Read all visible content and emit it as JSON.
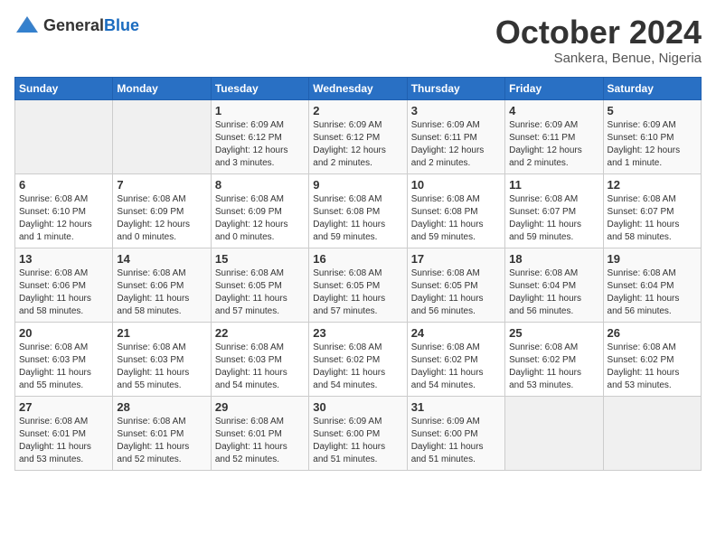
{
  "header": {
    "logo_general": "General",
    "logo_blue": "Blue",
    "month_title": "October 2024",
    "subtitle": "Sankera, Benue, Nigeria"
  },
  "days_of_week": [
    "Sunday",
    "Monday",
    "Tuesday",
    "Wednesday",
    "Thursday",
    "Friday",
    "Saturday"
  ],
  "weeks": [
    [
      {
        "day": "",
        "content": ""
      },
      {
        "day": "",
        "content": ""
      },
      {
        "day": "1",
        "content": "Sunrise: 6:09 AM\nSunset: 6:12 PM\nDaylight: 12 hours\nand 3 minutes."
      },
      {
        "day": "2",
        "content": "Sunrise: 6:09 AM\nSunset: 6:12 PM\nDaylight: 12 hours\nand 2 minutes."
      },
      {
        "day": "3",
        "content": "Sunrise: 6:09 AM\nSunset: 6:11 PM\nDaylight: 12 hours\nand 2 minutes."
      },
      {
        "day": "4",
        "content": "Sunrise: 6:09 AM\nSunset: 6:11 PM\nDaylight: 12 hours\nand 2 minutes."
      },
      {
        "day": "5",
        "content": "Sunrise: 6:09 AM\nSunset: 6:10 PM\nDaylight: 12 hours\nand 1 minute."
      }
    ],
    [
      {
        "day": "6",
        "content": "Sunrise: 6:08 AM\nSunset: 6:10 PM\nDaylight: 12 hours\nand 1 minute."
      },
      {
        "day": "7",
        "content": "Sunrise: 6:08 AM\nSunset: 6:09 PM\nDaylight: 12 hours\nand 0 minutes."
      },
      {
        "day": "8",
        "content": "Sunrise: 6:08 AM\nSunset: 6:09 PM\nDaylight: 12 hours\nand 0 minutes."
      },
      {
        "day": "9",
        "content": "Sunrise: 6:08 AM\nSunset: 6:08 PM\nDaylight: 11 hours\nand 59 minutes."
      },
      {
        "day": "10",
        "content": "Sunrise: 6:08 AM\nSunset: 6:08 PM\nDaylight: 11 hours\nand 59 minutes."
      },
      {
        "day": "11",
        "content": "Sunrise: 6:08 AM\nSunset: 6:07 PM\nDaylight: 11 hours\nand 59 minutes."
      },
      {
        "day": "12",
        "content": "Sunrise: 6:08 AM\nSunset: 6:07 PM\nDaylight: 11 hours\nand 58 minutes."
      }
    ],
    [
      {
        "day": "13",
        "content": "Sunrise: 6:08 AM\nSunset: 6:06 PM\nDaylight: 11 hours\nand 58 minutes."
      },
      {
        "day": "14",
        "content": "Sunrise: 6:08 AM\nSunset: 6:06 PM\nDaylight: 11 hours\nand 58 minutes."
      },
      {
        "day": "15",
        "content": "Sunrise: 6:08 AM\nSunset: 6:05 PM\nDaylight: 11 hours\nand 57 minutes."
      },
      {
        "day": "16",
        "content": "Sunrise: 6:08 AM\nSunset: 6:05 PM\nDaylight: 11 hours\nand 57 minutes."
      },
      {
        "day": "17",
        "content": "Sunrise: 6:08 AM\nSunset: 6:05 PM\nDaylight: 11 hours\nand 56 minutes."
      },
      {
        "day": "18",
        "content": "Sunrise: 6:08 AM\nSunset: 6:04 PM\nDaylight: 11 hours\nand 56 minutes."
      },
      {
        "day": "19",
        "content": "Sunrise: 6:08 AM\nSunset: 6:04 PM\nDaylight: 11 hours\nand 56 minutes."
      }
    ],
    [
      {
        "day": "20",
        "content": "Sunrise: 6:08 AM\nSunset: 6:03 PM\nDaylight: 11 hours\nand 55 minutes."
      },
      {
        "day": "21",
        "content": "Sunrise: 6:08 AM\nSunset: 6:03 PM\nDaylight: 11 hours\nand 55 minutes."
      },
      {
        "day": "22",
        "content": "Sunrise: 6:08 AM\nSunset: 6:03 PM\nDaylight: 11 hours\nand 54 minutes."
      },
      {
        "day": "23",
        "content": "Sunrise: 6:08 AM\nSunset: 6:02 PM\nDaylight: 11 hours\nand 54 minutes."
      },
      {
        "day": "24",
        "content": "Sunrise: 6:08 AM\nSunset: 6:02 PM\nDaylight: 11 hours\nand 54 minutes."
      },
      {
        "day": "25",
        "content": "Sunrise: 6:08 AM\nSunset: 6:02 PM\nDaylight: 11 hours\nand 53 minutes."
      },
      {
        "day": "26",
        "content": "Sunrise: 6:08 AM\nSunset: 6:02 PM\nDaylight: 11 hours\nand 53 minutes."
      }
    ],
    [
      {
        "day": "27",
        "content": "Sunrise: 6:08 AM\nSunset: 6:01 PM\nDaylight: 11 hours\nand 53 minutes."
      },
      {
        "day": "28",
        "content": "Sunrise: 6:08 AM\nSunset: 6:01 PM\nDaylight: 11 hours\nand 52 minutes."
      },
      {
        "day": "29",
        "content": "Sunrise: 6:08 AM\nSunset: 6:01 PM\nDaylight: 11 hours\nand 52 minutes."
      },
      {
        "day": "30",
        "content": "Sunrise: 6:09 AM\nSunset: 6:00 PM\nDaylight: 11 hours\nand 51 minutes."
      },
      {
        "day": "31",
        "content": "Sunrise: 6:09 AM\nSunset: 6:00 PM\nDaylight: 11 hours\nand 51 minutes."
      },
      {
        "day": "",
        "content": ""
      },
      {
        "day": "",
        "content": ""
      }
    ]
  ]
}
